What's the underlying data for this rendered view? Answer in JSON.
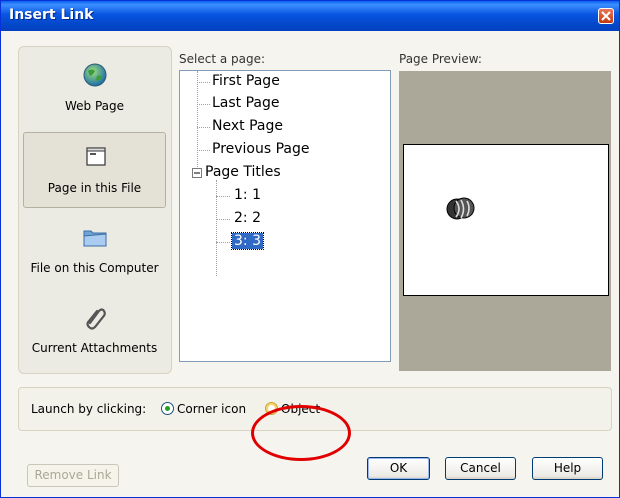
{
  "window": {
    "title": "Insert Link"
  },
  "nav": {
    "items": [
      {
        "label": "Web Page",
        "icon": "globe-icon",
        "selected": false
      },
      {
        "label": "Page in this File",
        "icon": "page-window-icon",
        "selected": true
      },
      {
        "label": "File on this Computer",
        "icon": "folder-icon",
        "selected": false
      },
      {
        "label": "Current Attachments",
        "icon": "paperclip-icon",
        "selected": false
      }
    ]
  },
  "page_select": {
    "label": "Select a page:",
    "items": [
      {
        "label": "First Page"
      },
      {
        "label": "Last Page"
      },
      {
        "label": "Next Page"
      },
      {
        "label": "Previous Page"
      },
      {
        "label": "Page Titles",
        "expanded": true,
        "children": [
          {
            "label": "1: 1"
          },
          {
            "label": "2: 2"
          },
          {
            "label": "3: 3",
            "selected": true
          }
        ]
      }
    ]
  },
  "preview": {
    "label": "Page Preview:"
  },
  "launch": {
    "label": "Launch by clicking:",
    "options": [
      {
        "label": "Corner icon",
        "checked": true
      },
      {
        "label": "Object",
        "checked": false
      }
    ]
  },
  "buttons": {
    "remove_link": "Remove Link",
    "ok": "OK",
    "cancel": "Cancel",
    "help": "Help"
  },
  "colors": {
    "title_bar": "#0855E0",
    "selection": "#316AC5",
    "annotation": "#E00000",
    "preview_bg": "#ACA899"
  }
}
